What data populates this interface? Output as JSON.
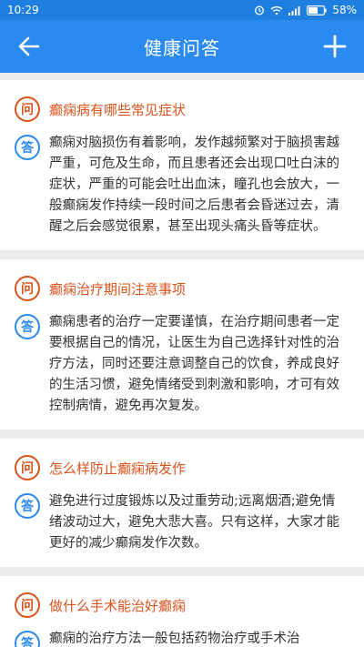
{
  "status": {
    "time": "10:29",
    "battery": "58%"
  },
  "header": {
    "title": "健康问答"
  },
  "badges": {
    "question": "问",
    "answer": "答"
  },
  "items": [
    {
      "question": "癫痫病有哪些常见症状",
      "answer": "癫痫对脑损伤有着影响，发作越频繁对于脑损害越严重，可危及生命，而且患者还会出现口吐白沫的症状，严重的可能会吐出血沫，瞳孔也会放大，一般癫痫发作持续一段时间之后患者会昏迷过去，清醒之后会感觉很累，甚至出现头痛头昏等症状。"
    },
    {
      "question": "癫痫治疗期间注意事项",
      "answer": "癫痫患者的治疗一定要谨慎，在治疗期间患者一定要根据自己的情况，让医生为自己选择针对性的治疗方法，同时还要注意调整自己的饮食，养成良好的生活习惯，避免情绪受到刺激和影响，才可有效控制病情，避免再次复发。"
    },
    {
      "question": "怎么样防止癫痫病发作",
      "answer": "避免进行过度锻炼以及过重劳动;远离烟酒;避免情绪波动过大，避免大悲大喜。只有这样，大家才能更好的减少癫痫发作次数。"
    },
    {
      "question": "做什么手术能治好癫痫",
      "answer": "癫痫的治疗方法一般包括药物治疗或手术治"
    }
  ]
}
